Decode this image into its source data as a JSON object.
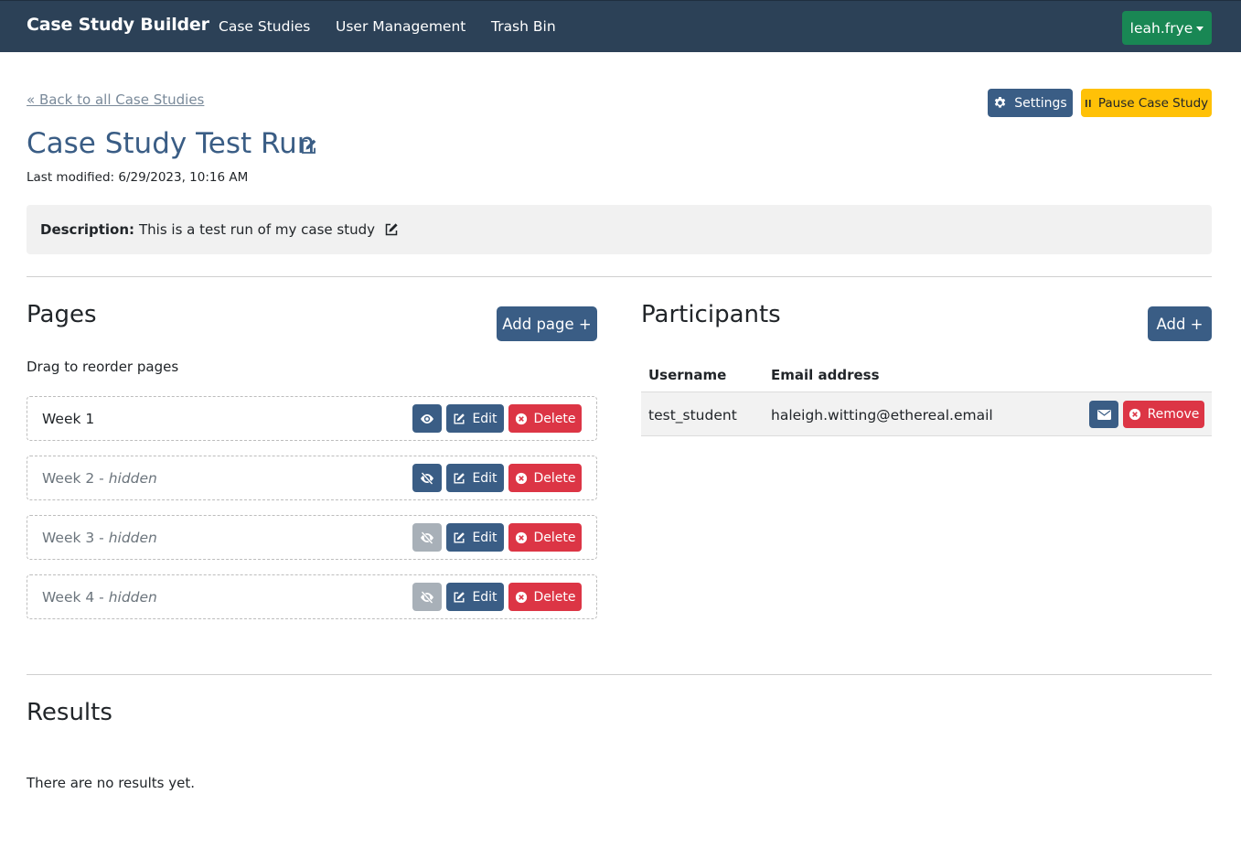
{
  "navbar": {
    "brand": "Case Study Builder",
    "links": [
      "Case Studies",
      "User Management",
      "Trash Bin"
    ],
    "user": "leah.frye"
  },
  "header": {
    "back_link": "« Back to all Case Studies",
    "settings_label": "Settings",
    "pause_label": "Pause Case Study",
    "title": "Case Study Test Run",
    "last_modified": "Last modified: 6/29/2023, 10:16 AM"
  },
  "description": {
    "label": "Description:",
    "text": "This is a test run of my case study"
  },
  "pages": {
    "heading": "Pages",
    "add_label": "Add page +",
    "drag_note": "Drag to reorder pages",
    "edit_label": "Edit",
    "delete_label": "Delete",
    "items": [
      {
        "name": "Week 1",
        "suffix": "",
        "hidden": false,
        "eye_enabled": true
      },
      {
        "name": "Week 2 - ",
        "suffix": "hidden",
        "hidden": true,
        "eye_enabled": true
      },
      {
        "name": "Week 3 - ",
        "suffix": "hidden",
        "hidden": true,
        "eye_enabled": false
      },
      {
        "name": "Week 4 - ",
        "suffix": "hidden",
        "hidden": true,
        "eye_enabled": false
      }
    ]
  },
  "participants": {
    "heading": "Participants",
    "add_label": "Add +",
    "columns": [
      "Username",
      "Email address"
    ],
    "remove_label": "Remove",
    "rows": [
      {
        "username": "test_student",
        "email": "haleigh.witting@ethereal.email"
      }
    ]
  },
  "results": {
    "heading": "Results",
    "empty_text": "There are no results yet."
  },
  "colors": {
    "navbar": "#2c4157",
    "primary": "#3a5d85",
    "success": "#198754",
    "warning": "#ffc107",
    "danger": "#dc3545"
  },
  "icons": {
    "settings": "gear-icon",
    "pause": "pause-icon",
    "edit": "pencil-square-icon",
    "visible": "eye-icon",
    "hidden": "eye-slash-icon",
    "delete": "x-circle-icon",
    "email": "envelope-icon"
  }
}
